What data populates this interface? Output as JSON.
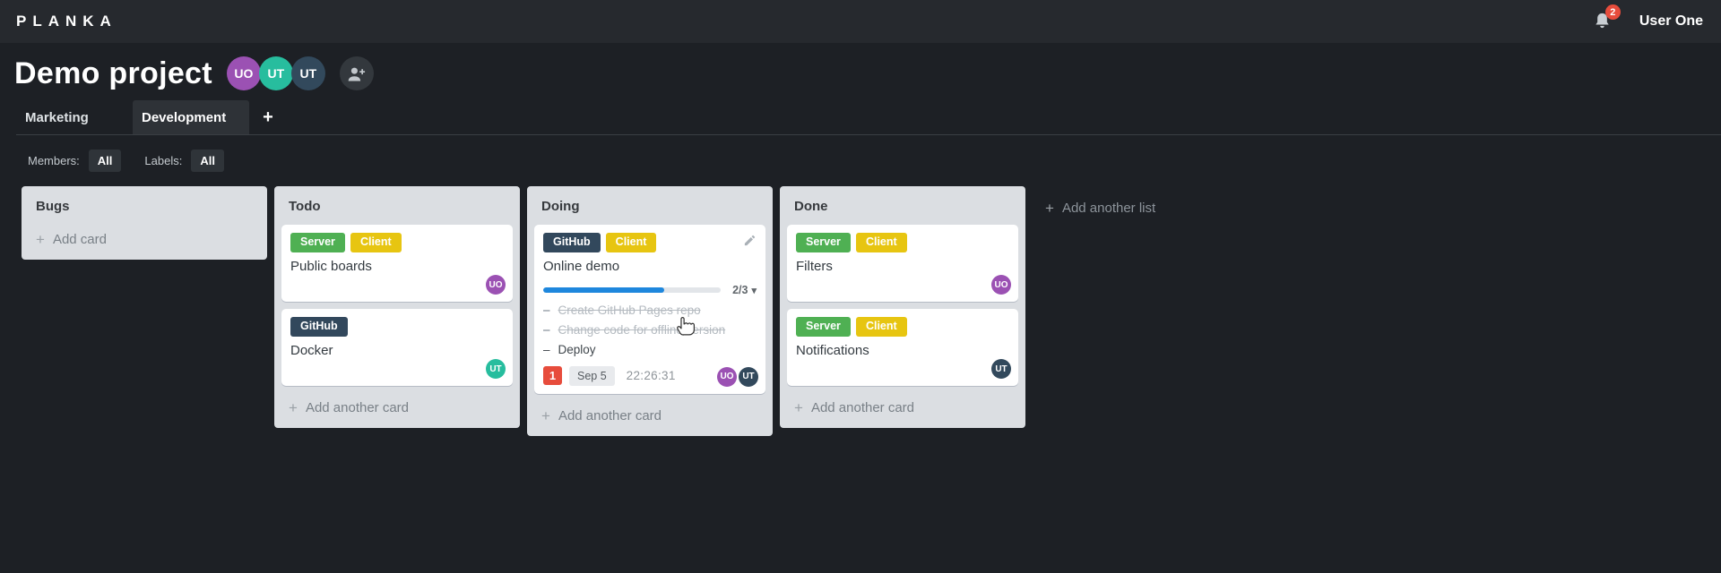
{
  "topbar": {
    "logo": "PLANKA",
    "user_name": "User One",
    "notification_count": "2"
  },
  "header": {
    "title": "Demo project",
    "members": [
      {
        "initials": "UO",
        "color": "#9b51b3"
      },
      {
        "initials": "UT",
        "color": "#27bd9e"
      },
      {
        "initials": "UT",
        "color": "#32495c"
      }
    ]
  },
  "tabs": {
    "items": [
      {
        "label": "Marketing",
        "active": false
      },
      {
        "label": "Development",
        "active": true
      }
    ],
    "add_button": "+"
  },
  "filters": {
    "members_label": "Members:",
    "members_value": "All",
    "labels_label": "Labels:",
    "labels_value": "All"
  },
  "icons": {
    "plus": "+",
    "caret_down": "▾",
    "bell": "bell-icon",
    "add_member": "user-add-icon",
    "edit": "pencil-icon",
    "cursor": "hand-cursor"
  },
  "board": {
    "add_list_label": "Add another list",
    "lists": [
      {
        "name": "Bugs",
        "add_card_label": "Add card",
        "cards": []
      },
      {
        "name": "Todo",
        "add_card_label": "Add another card",
        "cards": [
          {
            "title": "Public boards",
            "labels": [
              {
                "text": "Server",
                "color": "#4fb053"
              },
              {
                "text": "Client",
                "color": "#e7c511"
              }
            ],
            "members": [
              {
                "initials": "UO",
                "color": "#9b51b3"
              }
            ]
          },
          {
            "title": "Docker",
            "labels": [
              {
                "text": "GitHub",
                "color": "#32485c"
              }
            ],
            "members": [
              {
                "initials": "UT",
                "color": "#27bd9e"
              }
            ]
          }
        ]
      },
      {
        "name": "Doing",
        "add_card_label": "Add another card",
        "cards": [
          {
            "title": "Online demo",
            "editable": true,
            "labels": [
              {
                "text": "GitHub",
                "color": "#32485c"
              },
              {
                "text": "Client",
                "color": "#e7c511"
              }
            ],
            "progress": {
              "completed": 2,
              "total": 3,
              "text": "2/3",
              "percent": 68,
              "bar_color": "#1e87dd"
            },
            "tasks": [
              {
                "text": "Create GitHub Pages repo",
                "done": true
              },
              {
                "text": "Change code for offline version",
                "done": true
              },
              {
                "text": "Deploy",
                "done": false
              }
            ],
            "notification_count": "1",
            "notification_color": "#e74c3c",
            "due_date": "Sep 5",
            "timer": "22:26:31",
            "members": [
              {
                "initials": "UO",
                "color": "#9b51b3"
              },
              {
                "initials": "UT",
                "color": "#32495c"
              }
            ]
          }
        ]
      },
      {
        "name": "Done",
        "add_card_label": "Add another card",
        "cards": [
          {
            "title": "Filters",
            "labels": [
              {
                "text": "Server",
                "color": "#4fb053"
              },
              {
                "text": "Client",
                "color": "#e7c511"
              }
            ],
            "members": [
              {
                "initials": "UO",
                "color": "#9b51b3"
              }
            ]
          },
          {
            "title": "Notifications",
            "labels": [
              {
                "text": "Server",
                "color": "#4fb053"
              },
              {
                "text": "Client",
                "color": "#e7c511"
              }
            ],
            "members": [
              {
                "initials": "UT",
                "color": "#32495c"
              }
            ]
          }
        ]
      }
    ]
  }
}
